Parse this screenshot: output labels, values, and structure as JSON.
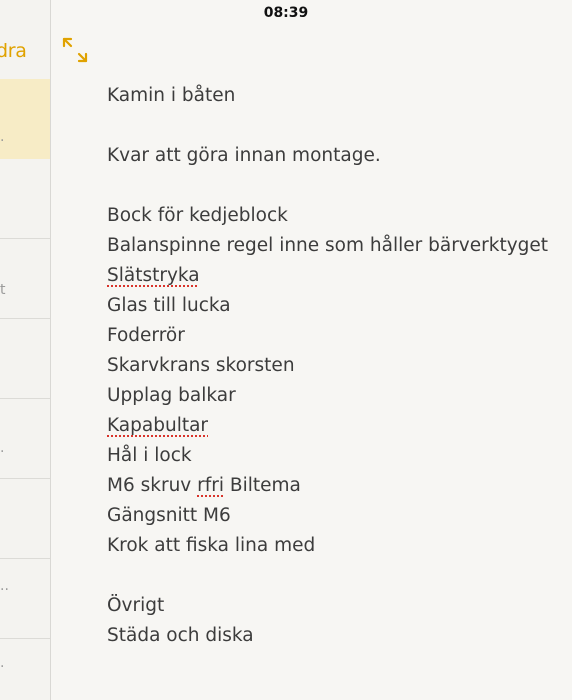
{
  "status_bar": {
    "time": "08:39"
  },
  "sidebar": {
    "edit_label": "dra",
    "row_marks": [
      ".",
      "t",
      ".",
      "..",
      "."
    ]
  },
  "note": {
    "title": "Kamin i båten",
    "subtitle": "Kvar att göra innan montage.",
    "items": [
      "Bock för kedjeblock",
      "Balanspinne regel inne som håller bärverktyget",
      "Slätstryka",
      "Glas till lucka",
      "Foderrör",
      "Skarvkrans skorsten",
      "Upplag balkar",
      "Kapabultar",
      "Hål i lock",
      "M6 skruv ",
      "Gängsnitt M6",
      "Krok att fiska lina med"
    ],
    "item_m6_misspelled": "rfri",
    "item_m6_suffix": " Biltema",
    "other_heading": "Övrigt",
    "other_items": [
      "Städa och diska"
    ]
  },
  "colors": {
    "accent": "#e0a200",
    "selected_row": "#f7ecc6",
    "spellcheck": "#d9342b"
  },
  "icons": {
    "expand": "expand-arrows-icon"
  }
}
